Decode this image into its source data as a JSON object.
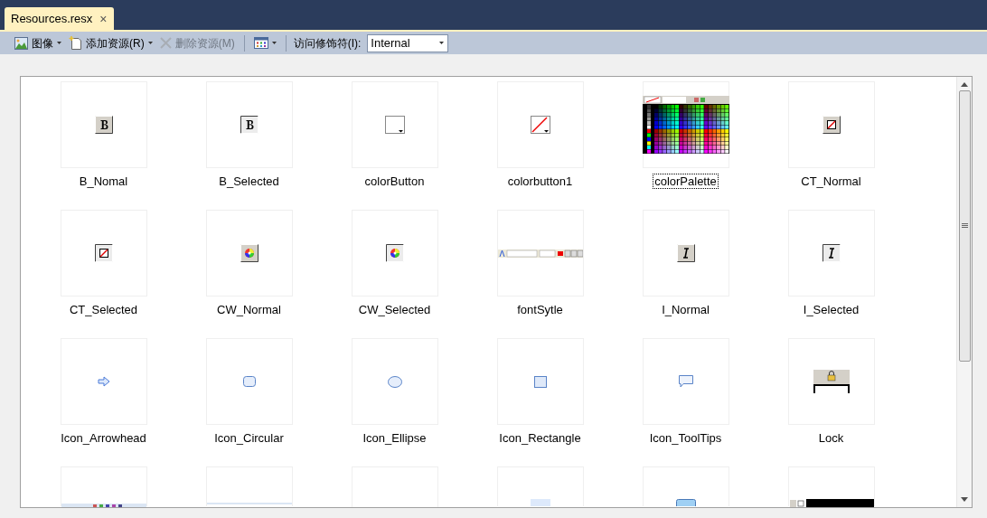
{
  "tab": {
    "title": "Resources.resx",
    "close": "×",
    "selected": true
  },
  "toolbar": {
    "buttons": [
      {
        "kind": "image",
        "label": "图像",
        "dropdown": true,
        "disabled": false
      },
      {
        "kind": "add",
        "label": "添加资源(R)",
        "dropdown": true,
        "disabled": false
      },
      {
        "kind": "delete",
        "label": "删除资源(M)",
        "disabled": true
      },
      {
        "kind": "view",
        "dropdown": true,
        "disabled": false
      }
    ],
    "access_label": "访问修饰符(I):",
    "access_value": "Internal"
  },
  "resources": [
    {
      "name": "B_Nomal",
      "kind": "bold",
      "selected": false
    },
    {
      "name": "B_Selected",
      "kind": "bold-pressed",
      "selected": false
    },
    {
      "name": "colorButton",
      "kind": "color-button",
      "selected": false
    },
    {
      "name": "colorbutton1",
      "kind": "color-button-line",
      "selected": false
    },
    {
      "name": "colorPalette",
      "kind": "palette",
      "selected": true
    },
    {
      "name": "CT_Normal",
      "kind": "ct",
      "selected": false
    },
    {
      "name": "CT_Selected",
      "kind": "ct-pressed",
      "selected": false
    },
    {
      "name": "CW_Normal",
      "kind": "cw",
      "selected": false
    },
    {
      "name": "CW_Selected",
      "kind": "cw-pressed",
      "selected": false
    },
    {
      "name": "fontSytle",
      "kind": "font-bar",
      "selected": false
    },
    {
      "name": "I_Normal",
      "kind": "italic",
      "selected": false
    },
    {
      "name": "I_Selected",
      "kind": "italic-pressed",
      "selected": false
    },
    {
      "name": "Icon_Arrowhead",
      "kind": "arrow",
      "selected": false
    },
    {
      "name": "Icon_Circular",
      "kind": "rounded",
      "selected": false
    },
    {
      "name": "Icon_Ellipse",
      "kind": "ellipse",
      "selected": false
    },
    {
      "name": "Icon_Rectangle",
      "kind": "rectangle",
      "selected": false
    },
    {
      "name": "Icon_ToolTips",
      "kind": "tooltip",
      "selected": false
    },
    {
      "name": "Lock",
      "kind": "lock",
      "selected": false
    },
    {
      "kind": "strip"
    },
    {
      "kind": "line"
    },
    {
      "kind": "blank"
    },
    {
      "kind": "light-square"
    },
    {
      "kind": "blue-button"
    },
    {
      "kind": "text-bar"
    }
  ]
}
